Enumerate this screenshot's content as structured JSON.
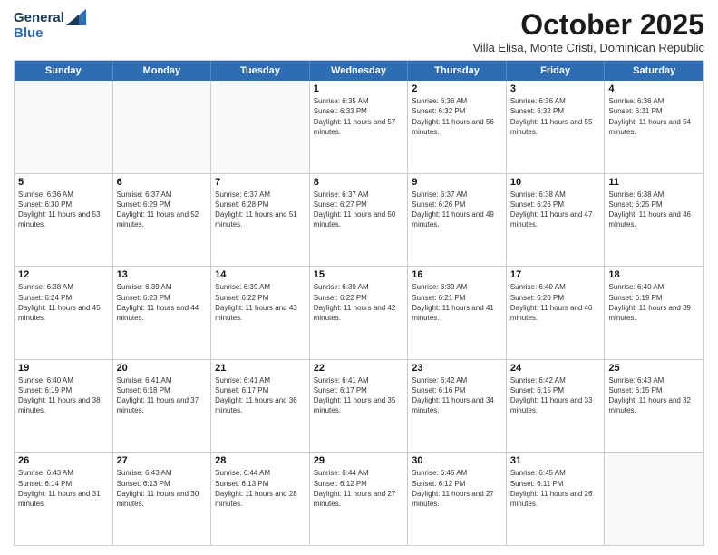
{
  "header": {
    "logo_general": "General",
    "logo_blue": "Blue",
    "month": "October 2025",
    "location": "Villa Elisa, Monte Cristi, Dominican Republic"
  },
  "days_of_week": [
    "Sunday",
    "Monday",
    "Tuesday",
    "Wednesday",
    "Thursday",
    "Friday",
    "Saturday"
  ],
  "weeks": [
    [
      {
        "day": "",
        "info": ""
      },
      {
        "day": "",
        "info": ""
      },
      {
        "day": "",
        "info": ""
      },
      {
        "day": "1",
        "info": "Sunrise: 6:35 AM\nSunset: 6:33 PM\nDaylight: 11 hours and 57 minutes."
      },
      {
        "day": "2",
        "info": "Sunrise: 6:36 AM\nSunset: 6:32 PM\nDaylight: 11 hours and 56 minutes."
      },
      {
        "day": "3",
        "info": "Sunrise: 6:36 AM\nSunset: 6:32 PM\nDaylight: 11 hours and 55 minutes."
      },
      {
        "day": "4",
        "info": "Sunrise: 6:36 AM\nSunset: 6:31 PM\nDaylight: 11 hours and 54 minutes."
      }
    ],
    [
      {
        "day": "5",
        "info": "Sunrise: 6:36 AM\nSunset: 6:30 PM\nDaylight: 11 hours and 53 minutes."
      },
      {
        "day": "6",
        "info": "Sunrise: 6:37 AM\nSunset: 6:29 PM\nDaylight: 11 hours and 52 minutes."
      },
      {
        "day": "7",
        "info": "Sunrise: 6:37 AM\nSunset: 6:28 PM\nDaylight: 11 hours and 51 minutes."
      },
      {
        "day": "8",
        "info": "Sunrise: 6:37 AM\nSunset: 6:27 PM\nDaylight: 11 hours and 50 minutes."
      },
      {
        "day": "9",
        "info": "Sunrise: 6:37 AM\nSunset: 6:26 PM\nDaylight: 11 hours and 49 minutes."
      },
      {
        "day": "10",
        "info": "Sunrise: 6:38 AM\nSunset: 6:26 PM\nDaylight: 11 hours and 47 minutes."
      },
      {
        "day": "11",
        "info": "Sunrise: 6:38 AM\nSunset: 6:25 PM\nDaylight: 11 hours and 46 minutes."
      }
    ],
    [
      {
        "day": "12",
        "info": "Sunrise: 6:38 AM\nSunset: 6:24 PM\nDaylight: 11 hours and 45 minutes."
      },
      {
        "day": "13",
        "info": "Sunrise: 6:39 AM\nSunset: 6:23 PM\nDaylight: 11 hours and 44 minutes."
      },
      {
        "day": "14",
        "info": "Sunrise: 6:39 AM\nSunset: 6:22 PM\nDaylight: 11 hours and 43 minutes."
      },
      {
        "day": "15",
        "info": "Sunrise: 6:39 AM\nSunset: 6:22 PM\nDaylight: 11 hours and 42 minutes."
      },
      {
        "day": "16",
        "info": "Sunrise: 6:39 AM\nSunset: 6:21 PM\nDaylight: 11 hours and 41 minutes."
      },
      {
        "day": "17",
        "info": "Sunrise: 6:40 AM\nSunset: 6:20 PM\nDaylight: 11 hours and 40 minutes."
      },
      {
        "day": "18",
        "info": "Sunrise: 6:40 AM\nSunset: 6:19 PM\nDaylight: 11 hours and 39 minutes."
      }
    ],
    [
      {
        "day": "19",
        "info": "Sunrise: 6:40 AM\nSunset: 6:19 PM\nDaylight: 11 hours and 38 minutes."
      },
      {
        "day": "20",
        "info": "Sunrise: 6:41 AM\nSunset: 6:18 PM\nDaylight: 11 hours and 37 minutes."
      },
      {
        "day": "21",
        "info": "Sunrise: 6:41 AM\nSunset: 6:17 PM\nDaylight: 11 hours and 36 minutes."
      },
      {
        "day": "22",
        "info": "Sunrise: 6:41 AM\nSunset: 6:17 PM\nDaylight: 11 hours and 35 minutes."
      },
      {
        "day": "23",
        "info": "Sunrise: 6:42 AM\nSunset: 6:16 PM\nDaylight: 11 hours and 34 minutes."
      },
      {
        "day": "24",
        "info": "Sunrise: 6:42 AM\nSunset: 6:15 PM\nDaylight: 11 hours and 33 minutes."
      },
      {
        "day": "25",
        "info": "Sunrise: 6:43 AM\nSunset: 6:15 PM\nDaylight: 11 hours and 32 minutes."
      }
    ],
    [
      {
        "day": "26",
        "info": "Sunrise: 6:43 AM\nSunset: 6:14 PM\nDaylight: 11 hours and 31 minutes."
      },
      {
        "day": "27",
        "info": "Sunrise: 6:43 AM\nSunset: 6:13 PM\nDaylight: 11 hours and 30 minutes."
      },
      {
        "day": "28",
        "info": "Sunrise: 6:44 AM\nSunset: 6:13 PM\nDaylight: 11 hours and 28 minutes."
      },
      {
        "day": "29",
        "info": "Sunrise: 6:44 AM\nSunset: 6:12 PM\nDaylight: 11 hours and 27 minutes."
      },
      {
        "day": "30",
        "info": "Sunrise: 6:45 AM\nSunset: 6:12 PM\nDaylight: 11 hours and 27 minutes."
      },
      {
        "day": "31",
        "info": "Sunrise: 6:45 AM\nSunset: 6:11 PM\nDaylight: 11 hours and 26 minutes."
      },
      {
        "day": "",
        "info": ""
      }
    ]
  ]
}
